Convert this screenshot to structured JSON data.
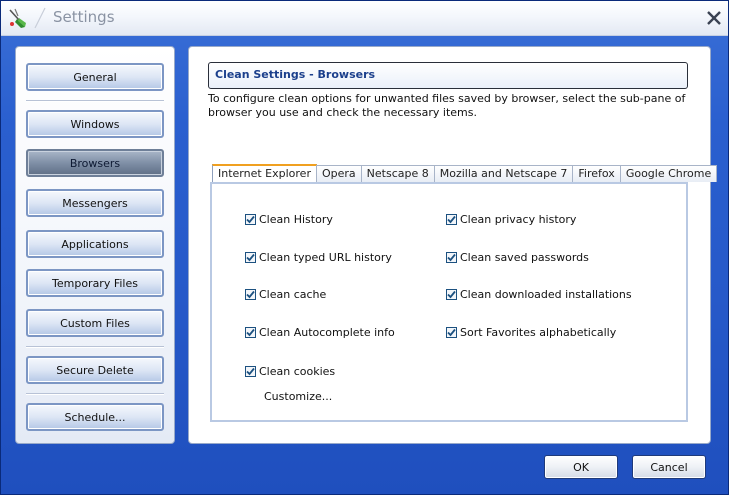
{
  "window": {
    "title": "Settings"
  },
  "sidebar": {
    "items": [
      {
        "label": "General"
      },
      {
        "label": "Windows"
      },
      {
        "label": "Browsers"
      },
      {
        "label": "Messengers"
      },
      {
        "label": "Applications"
      },
      {
        "label": "Temporary Files"
      },
      {
        "label": "Custom Files"
      },
      {
        "label": "Secure Delete"
      },
      {
        "label": "Schedule..."
      }
    ],
    "active": "Browsers"
  },
  "content": {
    "header": "Clean Settings - Browsers",
    "description": "To configure clean options for unwanted files saved by browser, select the sub-pane of browser you use and check the necessary items.",
    "tabs": [
      {
        "label": "Internet Explorer"
      },
      {
        "label": "Opera"
      },
      {
        "label": "Netscape 8"
      },
      {
        "label": "Mozilla and Netscape 7"
      },
      {
        "label": "Firefox"
      },
      {
        "label": "Google Chrome"
      }
    ],
    "active_tab": "Internet Explorer",
    "options": [
      {
        "label": "Clean History",
        "checked": true
      },
      {
        "label": "Clean privacy history",
        "checked": true
      },
      {
        "label": "Clean typed URL history",
        "checked": true
      },
      {
        "label": "Clean saved passwords",
        "checked": true
      },
      {
        "label": "Clean cache",
        "checked": true
      },
      {
        "label": "Clean downloaded installations",
        "checked": true
      },
      {
        "label": "Clean Autocomplete info",
        "checked": true
      },
      {
        "label": "Sort Favorites alphabetically",
        "checked": true
      },
      {
        "label": "Clean cookies",
        "checked": true
      }
    ],
    "customize_label": "Customize..."
  },
  "buttons": {
    "ok": "OK",
    "cancel": "Cancel"
  },
  "colors": {
    "background": "#2659c9",
    "accent_tab": "#f0a020",
    "header_text": "#1b3f8c"
  }
}
